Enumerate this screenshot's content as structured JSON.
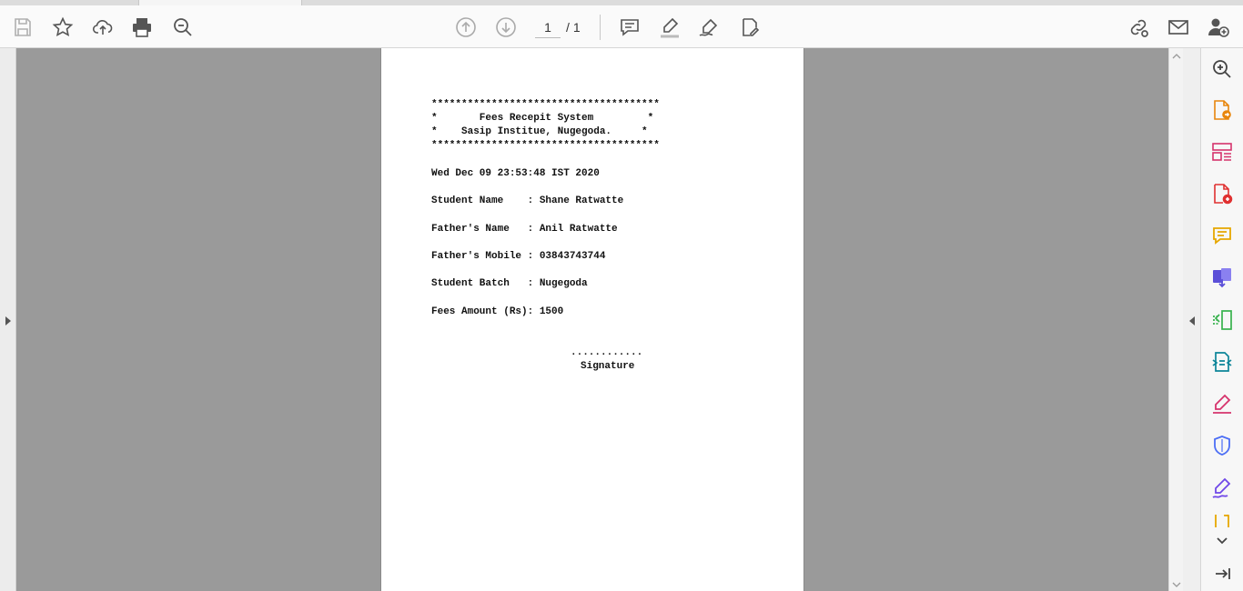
{
  "toolbar": {
    "page_current": "1",
    "page_separator": "/",
    "page_total": "1",
    "icons": [
      "save-icon",
      "star-icon",
      "upload-cloud-icon",
      "print-icon",
      "zoom-out-icon",
      "page-up-icon",
      "page-down-icon",
      "comment-icon",
      "highlight-icon",
      "draw-icon",
      "edit-pdf-icon",
      "share-link-icon",
      "email-icon",
      "add-user-icon"
    ]
  },
  "document": {
    "lines": [
      "**************************************",
      "*       Fees Recepit System         *",
      "*    Sasip Institue, Nugegoda.     *",
      "**************************************",
      "Wed Dec 09 23:53:48 IST 2020",
      "Student Name    : Shane Ratwatte",
      "Father's Name   : Anil Ratwatte",
      "Father's Mobile : 03843743744",
      "Student Batch   : Nugegoda",
      "Fees Amount (Rs): 1500"
    ],
    "signature_dots": "............",
    "signature_label": "Signature"
  },
  "tools_pane": {
    "icons": [
      "zoom-in-icon",
      "export-pdf-icon",
      "organize-pages-icon",
      "create-pdf-icon",
      "comment-tool-icon",
      "combine-files-icon",
      "compress-pdf-icon",
      "scan-ocr-icon",
      "fill-sign-icon",
      "protect-icon",
      "request-signature-icon",
      "more-tools-icon"
    ]
  },
  "colors": {
    "doc_background": "#9a9a9a",
    "page": "#ffffff",
    "toolbar": "#fafafa"
  }
}
